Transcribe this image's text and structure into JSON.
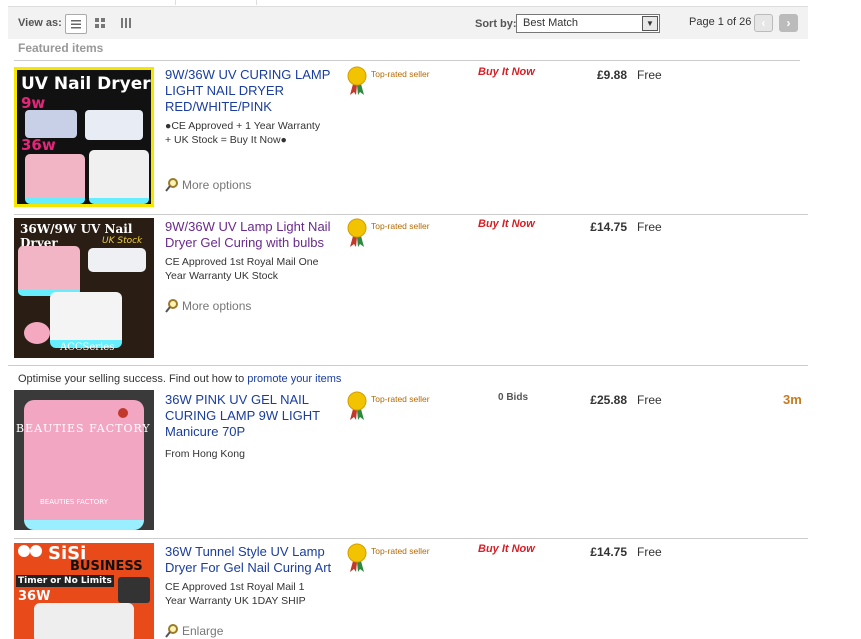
{
  "toolbar": {
    "view_as_label": "View as:",
    "sort_label": "Sort by:",
    "sort_value": "Best Match",
    "page_info": "Page 1 of 26"
  },
  "featured_label": "Featured items",
  "promo": {
    "text": "Optimise your selling success. Find out how to",
    "link": "promote your items"
  },
  "listings": [
    {
      "image_text": [
        "UV Nail Dryer",
        "9w",
        "36w"
      ],
      "title": "9W/36W UV CURING LAMP LIGHT NAIL DRYER RED/WHITE/PINK",
      "desc": "●CE Approved + 1 Year Warranty + UK Stock = Buy It Now●",
      "link": "More options",
      "badge": "Top-rated seller",
      "format": "Buy It Now",
      "price": "£9.88",
      "postage": "Free"
    },
    {
      "image_text": [
        "36W/9W UV Nail Dryer",
        "UK Stock",
        "ACCSeries"
      ],
      "title": "9W/36W UV Lamp Light Nail Dryer Gel Curing with bulbs",
      "desc": "CE Approved 1st Royal Mail One Year Warranty UK Stock",
      "link": "More options",
      "badge": "Top-rated seller",
      "format": "Buy It Now",
      "price": "£14.75",
      "postage": "Free"
    },
    {
      "image_text": [
        "BEAUTIES FACTORY",
        "BEAUTIES FACTORY"
      ],
      "title": "36W PINK UV GEL NAIL CURING LAMP 9W LIGHT Manicure 70P",
      "desc": "From Hong Kong",
      "badge": "Top-rated seller",
      "format": "0 Bids",
      "price": "£25.88",
      "postage": "Free",
      "time_left": "3m"
    },
    {
      "image_text": [
        "SiSi",
        "BUSINESS",
        "Timer or No Limits",
        "36W"
      ],
      "title": "36W Tunnel Style UV Lamp Dryer For Gel Nail Curing Art",
      "desc": "CE Approved 1st Royal Mail 1 Year Warranty UK 1DAY SHIP",
      "link": "Enlarge",
      "badge": "Top-rated seller",
      "format": "Buy It Now",
      "price": "£14.75",
      "postage": "Free"
    }
  ]
}
